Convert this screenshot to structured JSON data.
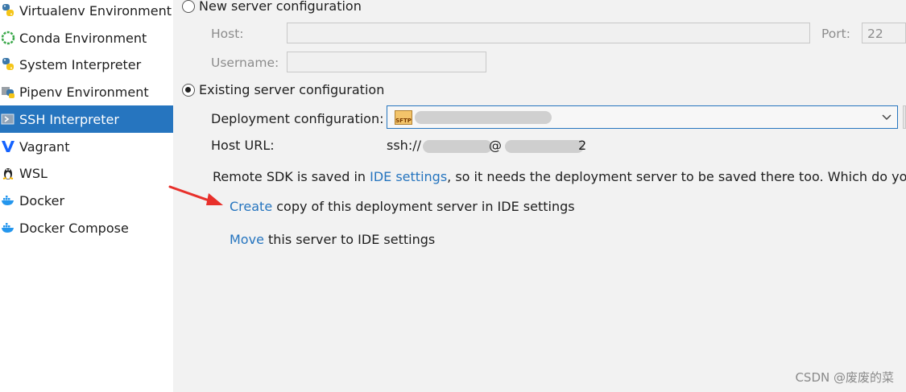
{
  "sidebar": {
    "items": [
      {
        "label": "Virtualenv Environment",
        "icon": "python-icon",
        "selected": false
      },
      {
        "label": "Conda Environment",
        "icon": "conda-icon",
        "selected": false
      },
      {
        "label": "System Interpreter",
        "icon": "python-icon",
        "selected": false
      },
      {
        "label": "Pipenv Environment",
        "icon": "pipenv-icon",
        "selected": false
      },
      {
        "label": "SSH Interpreter",
        "icon": "ssh-icon",
        "selected": true
      },
      {
        "label": "Vagrant",
        "icon": "vagrant-icon",
        "selected": false
      },
      {
        "label": "WSL",
        "icon": "linux-penguin-icon",
        "selected": false
      },
      {
        "label": "Docker",
        "icon": "docker-icon",
        "selected": false
      },
      {
        "label": "Docker Compose",
        "icon": "docker-icon",
        "selected": false
      }
    ]
  },
  "new_server": {
    "radio_label": "New server configuration",
    "host_label": "Host:",
    "port_label": "Port:",
    "port_value": "22",
    "username_label": "Username:"
  },
  "existing_server": {
    "radio_label": "Existing server configuration",
    "deployment_label": "Deployment configuration:",
    "deployment_badge": "SFTP",
    "host_url_label": "Host URL:",
    "host_url_prefix": "ssh://",
    "host_url_at": "@",
    "host_url_suffix": "2"
  },
  "remote_sdk": {
    "text_before": "Remote SDK is saved in ",
    "link": "IDE settings",
    "text_after": ", so it needs the deployment server to be saved there too. Which do you pref"
  },
  "actions": {
    "create_link": "Create",
    "create_text": " copy of this deployment server in IDE settings",
    "move_link": "Move",
    "move_text": " this server to IDE settings"
  },
  "watermark": "CSDN @废废的菜",
  "colors": {
    "accent": "#2675bf",
    "selection": "#2675bf",
    "annotation_arrow": "#e8302b"
  }
}
